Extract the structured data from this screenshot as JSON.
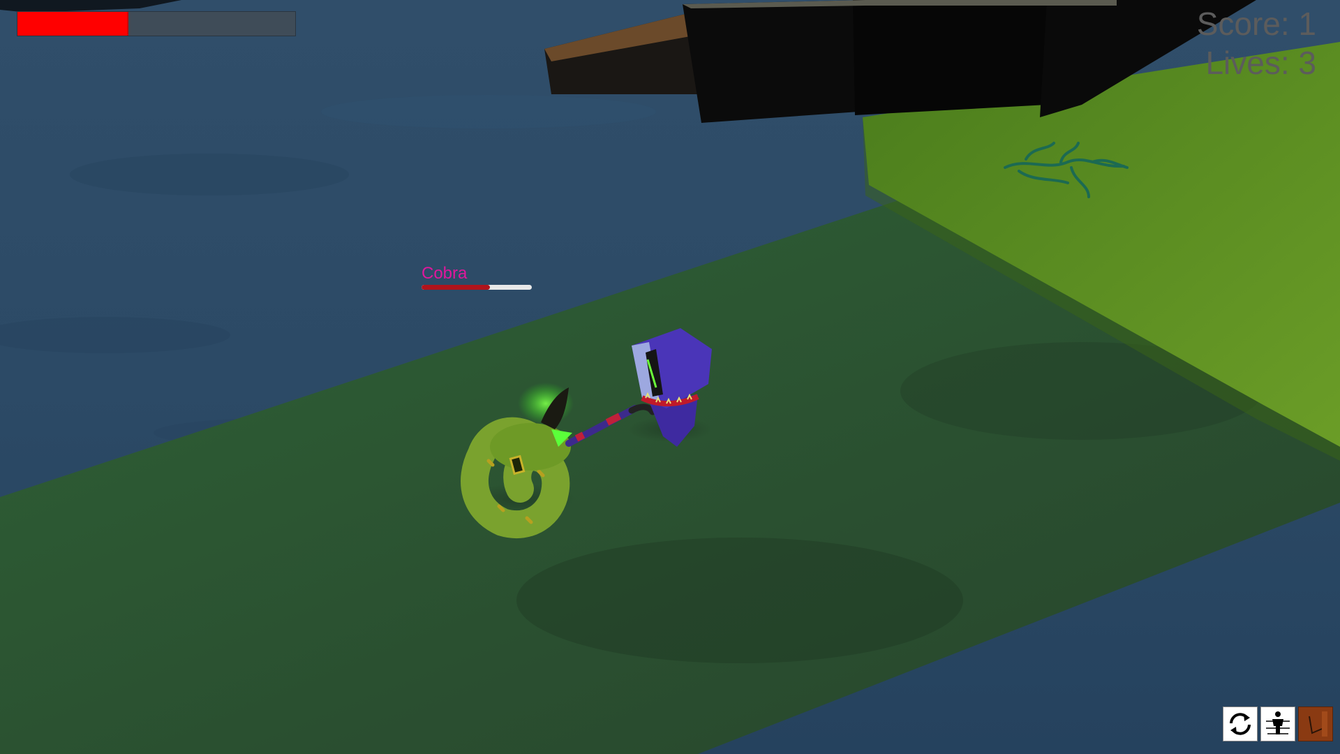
{
  "hud": {
    "player_health_fraction": 0.4,
    "score_text": "Score: 1",
    "lives_text": "Lives: 3"
  },
  "enemy": {
    "name": "Cobra",
    "health_fraction": 0.62
  },
  "actions": [
    {
      "icon": "refresh-icon"
    },
    {
      "icon": "character-icon"
    },
    {
      "icon": "spellbook-icon"
    }
  ],
  "colors": {
    "player_health": "#ff0000",
    "enemy_name": "#e0179c",
    "enemy_health": "#b0141c",
    "water": "#2b4a66",
    "path": "#2e5a33",
    "grass_platform": "#5c8f22",
    "player_robe": "#4a2aa6",
    "cobra": "#6f9a2a"
  }
}
